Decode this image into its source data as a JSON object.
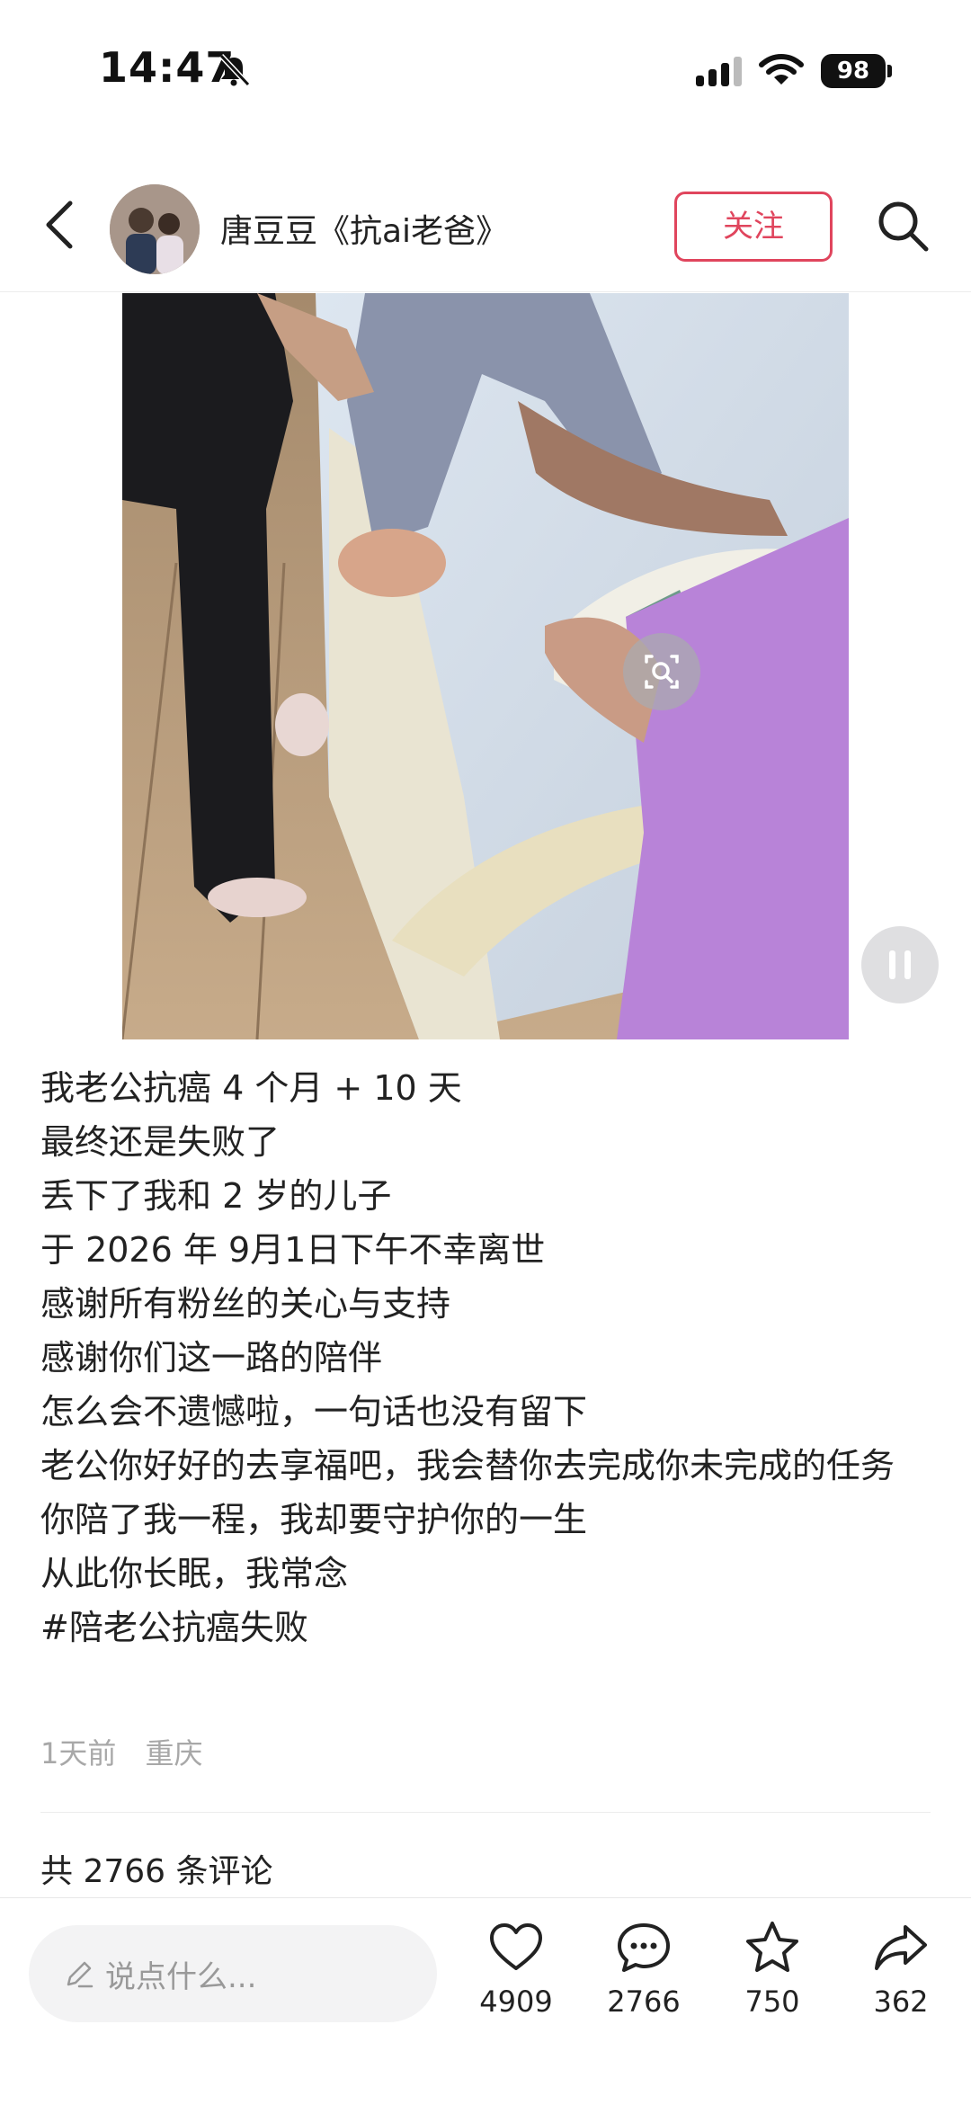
{
  "status_bar": {
    "time": "14:47",
    "battery": "98"
  },
  "header": {
    "author_name": "唐豆豆《抗ai老爸》",
    "follow_label": "关注"
  },
  "post": {
    "lines": [
      "我老公抗癌 4 个月 + 10 天",
      "最终还是失败了",
      "丢下了我和 2 岁的儿子",
      "于 2026 年 9月1日下午不幸离世",
      "感谢所有粉丝的关心与支持",
      "感谢你们这一路的陪伴",
      "怎么会不遗憾啦，一句话也没有留下",
      "老公你好好的去享福吧，我会替你去完成你未完成的任务",
      "你陪了我一程，我却要守护你的一生",
      "从此你长眠，我常念",
      "#陪老公抗癌失败"
    ],
    "time_ago": "1天前",
    "location": "重庆",
    "comment_total": "共 2766 条评论"
  },
  "bottom_bar": {
    "comment_placeholder": "说点什么...",
    "likes": "4909",
    "comments": "2766",
    "favorites": "750",
    "shares": "362"
  },
  "icons": {
    "back": "back-arrow-icon",
    "search": "search-icon",
    "scan": "image-search-icon",
    "pause": "pause-icon",
    "like": "heart-icon",
    "comment": "chat-bubble-icon",
    "favorite": "star-icon",
    "share": "share-arrow-icon"
  },
  "colors": {
    "accent": "#e0455d"
  }
}
